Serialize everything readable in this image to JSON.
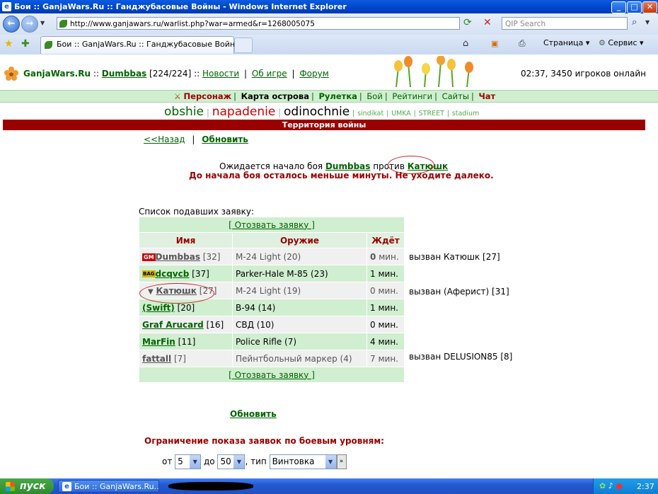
{
  "window": {
    "title": "Бои :: GanjaWars.Ru :: Ганджубасовые Войны - Windows Internet Explorer"
  },
  "browser": {
    "url": "http://www.ganjawars.ru/warlist.php?war=armed&r=1268005075",
    "search_placeholder": "QIP Search",
    "tab_title": "Бои :: GanjaWars.Ru :: Ганджубасовые Войны",
    "tools": {
      "page": "Страница",
      "service": "Сервис"
    }
  },
  "site": {
    "name": "GanjaWars.Ru",
    "sep": "::",
    "user": "Dumbbas",
    "hp": "[224/224]",
    "links": [
      "Новости",
      "Об игре",
      "Форум"
    ],
    "online": "02:37, 3450 игроков онлайн"
  },
  "menu": [
    "Персонаж",
    "Карта острова",
    "Рулетка",
    "Бой",
    "Рейтинги",
    "Сайты",
    "Чат"
  ],
  "categories": {
    "big": [
      "obshie",
      "napadenie",
      "odinochnie"
    ],
    "small": [
      "sindikat",
      "UMKA",
      "STREET",
      "stadium"
    ]
  },
  "section_title": "Территория войны",
  "nav": {
    "back": "<<Назад",
    "sep": "|",
    "refresh": "Обновить"
  },
  "waiting": {
    "prefix": "Ожидается начало боя",
    "player": "Dumbbas",
    "versus": "против",
    "opponent": "Катюшк",
    "warning": "До начала боя осталось меньше минуты. Не уходите далеко."
  },
  "list": {
    "label": "Список подавших заявку:",
    "withdraw": "[ Отозвать заявку ]",
    "headers": [
      "Имя",
      "Оружие",
      "Ждёт"
    ],
    "rows": [
      {
        "badge": "GM",
        "name": "Dumbbas",
        "level": "[32]",
        "weapon": "M-24 Light (20)",
        "wait": "0",
        "unit": "мин.",
        "note": "вызван Катюшк [27]"
      },
      {
        "badge": "BAG",
        "name": "dcqvcb",
        "level": "[37]",
        "weapon": "Parker-Hale M-85 (23)",
        "wait": "1",
        "unit": "мин.",
        "note": ""
      },
      {
        "badge": "",
        "name": "Катюшк",
        "level": "[27]",
        "weapon": "M-24 Light (19)",
        "wait": "0",
        "unit": "мин.",
        "note": "вызван (Аферист) [31]"
      },
      {
        "badge": "",
        "name": "(Swift)",
        "level": "[20]",
        "weapon": "B-94 (14)",
        "wait": "1",
        "unit": "мин.",
        "note": ""
      },
      {
        "badge": "",
        "name": "Graf Arucard",
        "level": "[16]",
        "weapon": "СВД (10)",
        "wait": "0",
        "unit": "мин.",
        "note": ""
      },
      {
        "badge": "",
        "name": "MarFin",
        "level": "[11]",
        "weapon": "Police Rifle (7)",
        "wait": "4",
        "unit": "мин.",
        "note": ""
      },
      {
        "badge": "",
        "name": "fattall",
        "level": "[7]",
        "weapon": "Пейнтбольный маркер (4)",
        "wait": "7",
        "unit": "мин.",
        "note": "вызван DELUSION85 [8]"
      }
    ]
  },
  "refresh": "Обновить",
  "limit": {
    "label": "Ограничение показа заявок по боевым уровням:",
    "from": "от",
    "from_value": "5",
    "to": "до",
    "to_value": "50",
    "type": ", тип",
    "type_value": "Винтовка"
  },
  "taskbar": {
    "start": "пуск",
    "item": "Бои :: GanjaWars.Ru...",
    "clock": "2:37"
  }
}
